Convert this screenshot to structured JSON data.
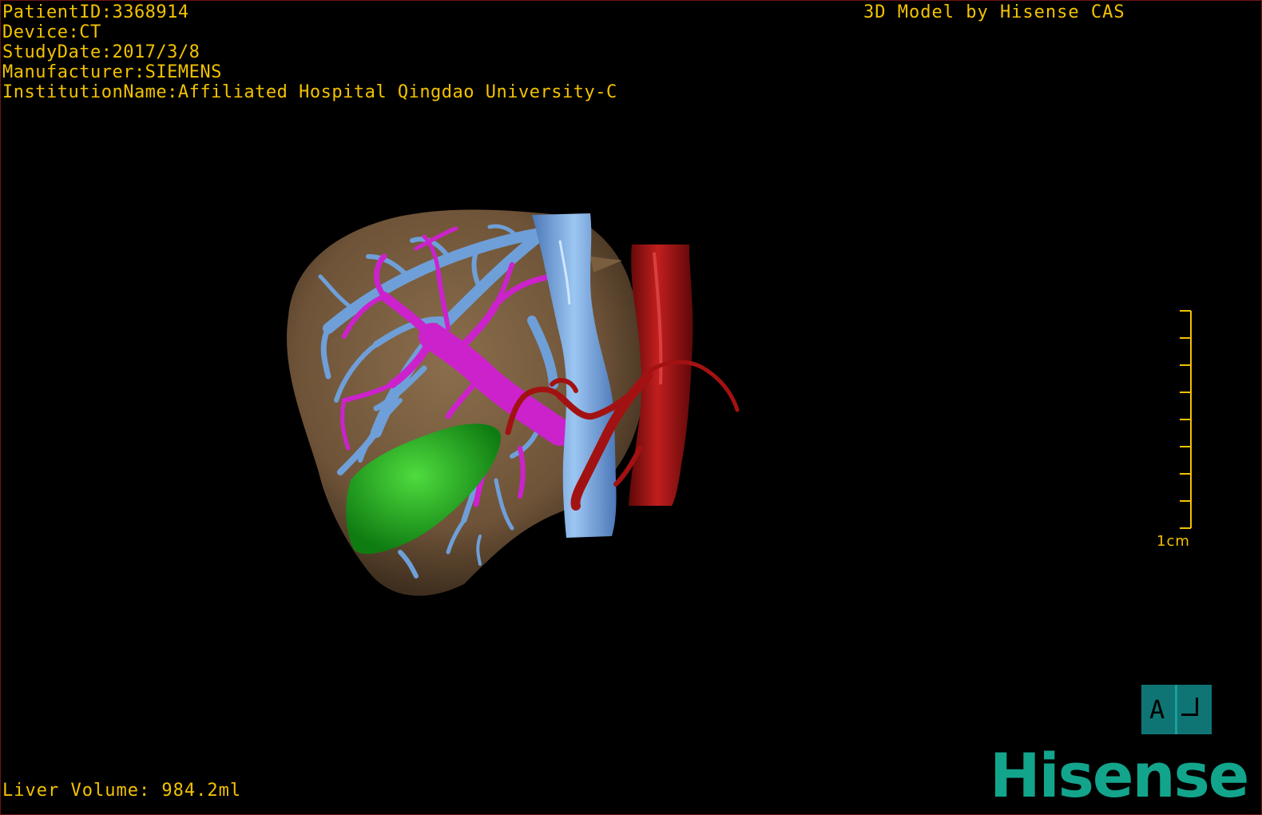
{
  "header": {
    "patient_id": "PatientID:3368914",
    "device": "Device:CT",
    "study_date": "StudyDate:2017/3/8",
    "manufacturer": "Manufacturer:SIEMENS",
    "institution": "InstitutionName:Affiliated Hospital Qingdao University-C"
  },
  "brand_title": "3D Model by Hisense CAS",
  "footer": {
    "liver_volume": "Liver Volume: 984.2ml"
  },
  "scale_bar": {
    "label": "1cm",
    "ticks": 8
  },
  "orientation": {
    "label": "A"
  },
  "logo": "Hisense",
  "colors": {
    "overlay_text": "#f2c200",
    "liver": "#7a5e3e",
    "hepatic_vein": "#6f9fd8",
    "portal_vein": "#cc22cc",
    "gallbladder": "#1fae23",
    "aorta": "#a31212",
    "logo": "#12a58c",
    "orientation_cube": "#0e7574"
  }
}
